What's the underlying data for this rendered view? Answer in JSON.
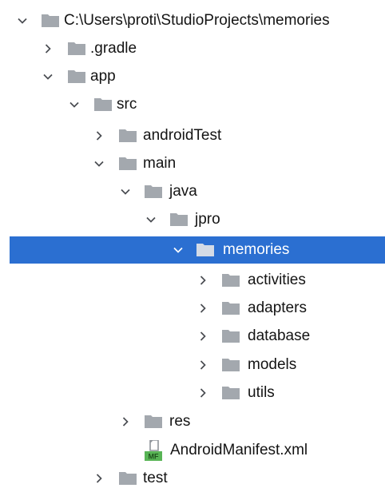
{
  "colors": {
    "folder": "#a3a8ae",
    "folder_selected": "#d4dbe6",
    "arrow": "#4a4d52",
    "selection": "#2b6fd1",
    "manifest_badge": "#58b455"
  },
  "tree": {
    "root": {
      "label": "C:\\Users\\proti\\StudioProjects\\memories",
      "icon": "folder-icon",
      "expanded": true
    },
    "gradle": {
      "label": ".gradle",
      "icon": "folder-icon",
      "expanded": false
    },
    "app": {
      "label": "app",
      "icon": "folder-icon",
      "expanded": true
    },
    "src": {
      "label": "src",
      "icon": "folder-icon",
      "expanded": true
    },
    "androidTest": {
      "label": "androidTest",
      "icon": "folder-icon",
      "expanded": false
    },
    "main": {
      "label": "main",
      "icon": "folder-icon",
      "expanded": true
    },
    "java": {
      "label": "java",
      "icon": "folder-icon",
      "expanded": true
    },
    "jpro": {
      "label": "jpro",
      "icon": "folder-icon",
      "expanded": true
    },
    "memories": {
      "label": "memories",
      "icon": "folder-icon",
      "expanded": true,
      "selected": true
    },
    "activities": {
      "label": "activities",
      "icon": "folder-icon",
      "expanded": false
    },
    "adapters": {
      "label": "adapters",
      "icon": "folder-icon",
      "expanded": false
    },
    "database": {
      "label": "database",
      "icon": "folder-icon",
      "expanded": false
    },
    "models": {
      "label": "models",
      "icon": "folder-icon",
      "expanded": false
    },
    "utils": {
      "label": "utils",
      "icon": "folder-icon",
      "expanded": false
    },
    "res": {
      "label": "res",
      "icon": "folder-icon",
      "expanded": false
    },
    "manifest": {
      "label": "AndroidManifest.xml",
      "icon": "manifest-file-icon",
      "badge": "MF"
    },
    "test": {
      "label": "test",
      "icon": "folder-icon",
      "expanded": false
    }
  }
}
